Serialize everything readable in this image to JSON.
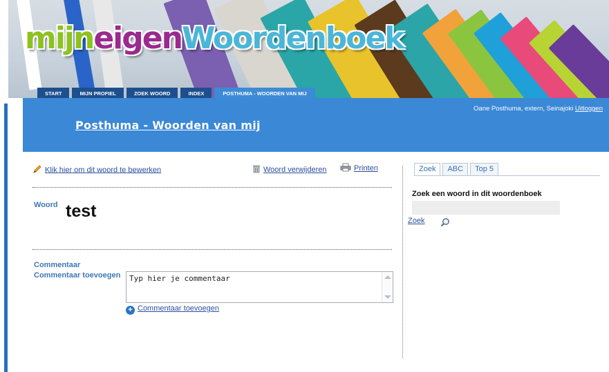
{
  "logo": {
    "part1": "mijn",
    "part2": "eigen",
    "part3": "Woordenboek"
  },
  "nav": {
    "tabs": [
      "START",
      "MIJN PROFIEL",
      "ZOEK WOORD",
      "INDEX",
      "POSTHUMA - WOORDEN VAN MIJ"
    ],
    "active": "POSTHUMA - WOORDEN VAN MIJ"
  },
  "header": {
    "user_info": "Oane Posthuma, extern, Seinajoki",
    "logout_label": "Uitloggen",
    "page_title": "Posthuma - Woorden van mij"
  },
  "actions": {
    "edit_label": "Klik hier om dit woord te bewerken",
    "delete_label": "Woord verwijderen",
    "print_label": "Printen"
  },
  "entry": {
    "word_label": "Woord",
    "word_value": "test",
    "comment_label": "Commentaar",
    "add_comment_label": "Commentaar toevoegen",
    "comment_placeholder": "Typ hier je commentaar",
    "add_comment_link": "Commentaar toevoegen"
  },
  "sidebar": {
    "tabs": [
      "Zoek",
      "ABC",
      "Top 5"
    ],
    "active_tab": "Zoek",
    "heading": "Zoek een woord in dit woordenboek",
    "search_value": "",
    "search_label": "Zoek"
  },
  "colors": {
    "header_blue": "#3b88d6",
    "nav_dark": "#1d4f8d",
    "link_blue": "#2c4f9e",
    "label_blue": "#3f77b8"
  },
  "icons": [
    "pencil-icon",
    "trash-icon",
    "printer-icon",
    "plus-circle-icon",
    "magnifier-icon"
  ]
}
